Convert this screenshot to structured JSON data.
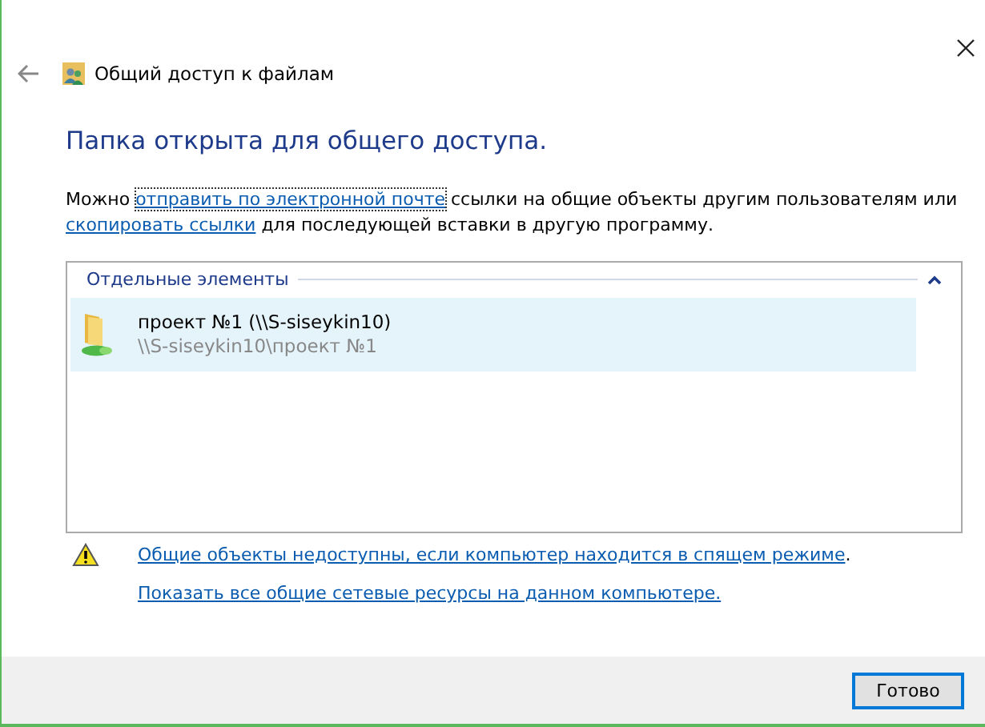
{
  "window": {
    "title": "Общий доступ к файлам"
  },
  "heading": "Папка открыта для общего доступа.",
  "message": [
    {
      "kind": "text",
      "text": "Можно "
    },
    {
      "kind": "link",
      "text": "отправить по электронной почте",
      "focused": true
    },
    {
      "kind": "text",
      "text": " ссылки на общие объекты другим пользователям или "
    },
    {
      "kind": "link",
      "text": "скопировать ссылки",
      "focused": false
    },
    {
      "kind": "text",
      "text": " для последующей вставки в другую программу."
    }
  ],
  "list": {
    "group": {
      "title": "Отдельные элементы",
      "expanded": true
    },
    "items": [
      {
        "name": "проект №1 (\\\\S-siseykin10)",
        "path": "\\\\S-siseykin10\\проект №1",
        "selected": true
      }
    ]
  },
  "notes": [
    {
      "kind": "warning",
      "parts": [
        {
          "kind": "link",
          "text": "Общие объекты недоступны, если компьютер находится в спящем режиме"
        },
        {
          "kind": "text",
          "text": "."
        }
      ]
    },
    {
      "kind": "plain",
      "parts": [
        {
          "kind": "link",
          "text": "Показать все общие сетевые ресурсы на данном компьютере."
        }
      ]
    }
  ],
  "buttons": [
    {
      "label": "Готово",
      "default": true
    }
  ]
}
